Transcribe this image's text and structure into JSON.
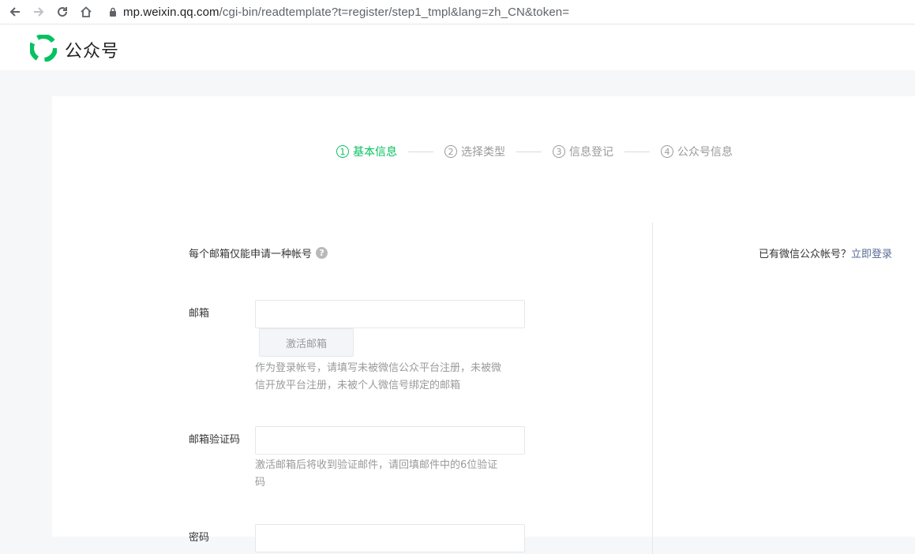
{
  "browser": {
    "url_host": "mp.weixin.qq.com",
    "url_path": "/cgi-bin/readtemplate?t=register/step1_tmpl&lang=zh_CN&token="
  },
  "header": {
    "brand": "公众号"
  },
  "steps": [
    {
      "num": "1",
      "label": "基本信息"
    },
    {
      "num": "2",
      "label": "选择类型"
    },
    {
      "num": "3",
      "label": "信息登记"
    },
    {
      "num": "4",
      "label": "公众号信息"
    }
  ],
  "form": {
    "notice": "每个邮箱仅能申请一种帐号",
    "email": {
      "label": "邮箱",
      "value": "",
      "activate_button": "激活邮箱",
      "hint": "作为登录帐号，请填写未被微信公众平台注册，未被微信开放平台注册，未被个人微信号绑定的邮箱"
    },
    "code": {
      "label": "邮箱验证码",
      "value": "",
      "hint": "激活邮箱后将收到验证邮件，请回填邮件中的6位验证码"
    },
    "password": {
      "label": "密码",
      "value": ""
    }
  },
  "login": {
    "text": "已有微信公众帐号？",
    "link": "立即登录"
  },
  "colors": {
    "accent": "#07c160",
    "link": "#576b95"
  }
}
